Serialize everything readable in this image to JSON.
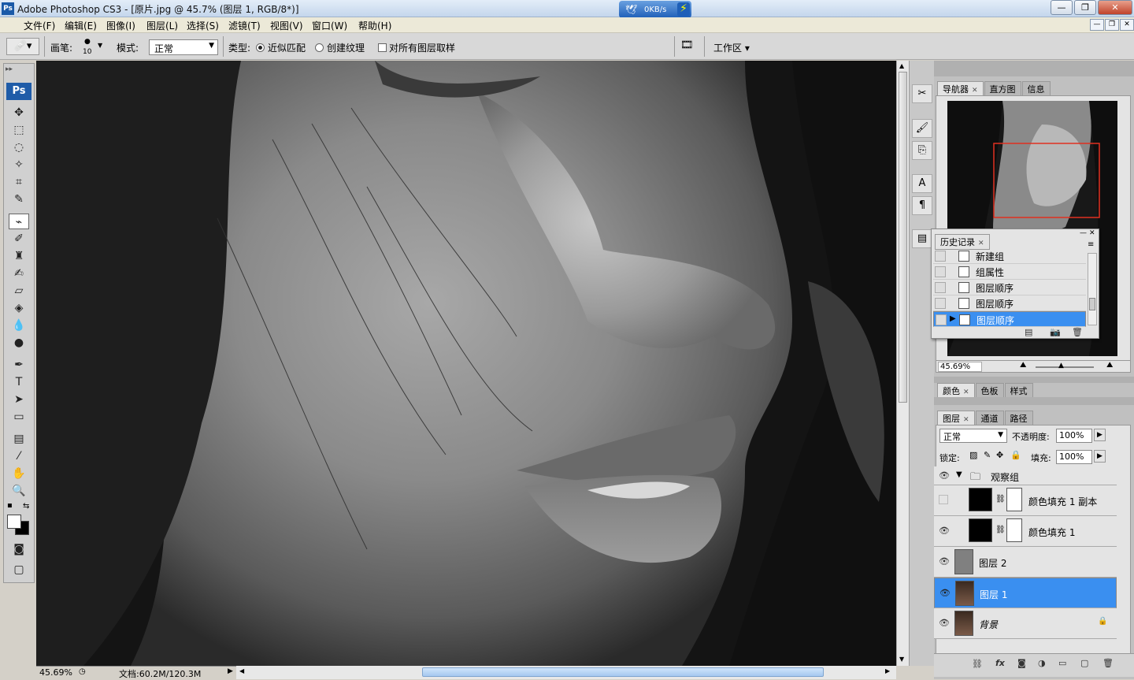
{
  "window": {
    "title": "Adobe Photoshop CS3 - [原片.jpg @ 45.7% (图层 1, RGB/8*)]",
    "app_icon": "Ps",
    "min": "—",
    "restore": "❐",
    "close": "✕"
  },
  "netmeter": {
    "speed": "0KB/s"
  },
  "menu": {
    "items": [
      "文件(F)",
      "编辑(E)",
      "图像(I)",
      "图层(L)",
      "选择(S)",
      "滤镜(T)",
      "视图(V)",
      "窗口(W)",
      "帮助(H)"
    ]
  },
  "options": {
    "brush_label": "画笔:",
    "brush_size": "10",
    "mode_label": "模式:",
    "mode_value": "正常",
    "type_label": "类型:",
    "radio1": "近似匹配",
    "radio2": "创建纹理",
    "sample_all": "对所有图层取样",
    "workspace": "工作区"
  },
  "toolbox": {
    "logo": "Ps"
  },
  "status": {
    "zoom": "45.69%",
    "doc": "文档:60.2M/120.3M"
  },
  "navigator": {
    "tabs": [
      "导航器",
      "直方图",
      "信息"
    ],
    "zoom": "45.69%"
  },
  "history": {
    "title": "历史记录",
    "items": [
      "新建组",
      "组属性",
      "图层顺序",
      "图层顺序",
      "图层顺序"
    ]
  },
  "color": {
    "tabs": [
      "颜色",
      "色板",
      "样式"
    ]
  },
  "layers": {
    "tabs": [
      "图层",
      "通道",
      "路径"
    ],
    "blend": "正常",
    "opacity_label": "不透明度:",
    "opacity": "100%",
    "lock_label": "锁定:",
    "fill_label": "填充:",
    "fill": "100%",
    "rows": [
      {
        "name": "观察组"
      },
      {
        "name": "颜色填充 1 副本"
      },
      {
        "name": "颜色填充 1"
      },
      {
        "name": "图层 2"
      },
      {
        "name": "图层 1"
      },
      {
        "name": "背景"
      }
    ]
  },
  "colors": {
    "accent": "#3a8ff0",
    "canvas_dark": "#1a1a1a",
    "nav_box": "#e03020"
  }
}
